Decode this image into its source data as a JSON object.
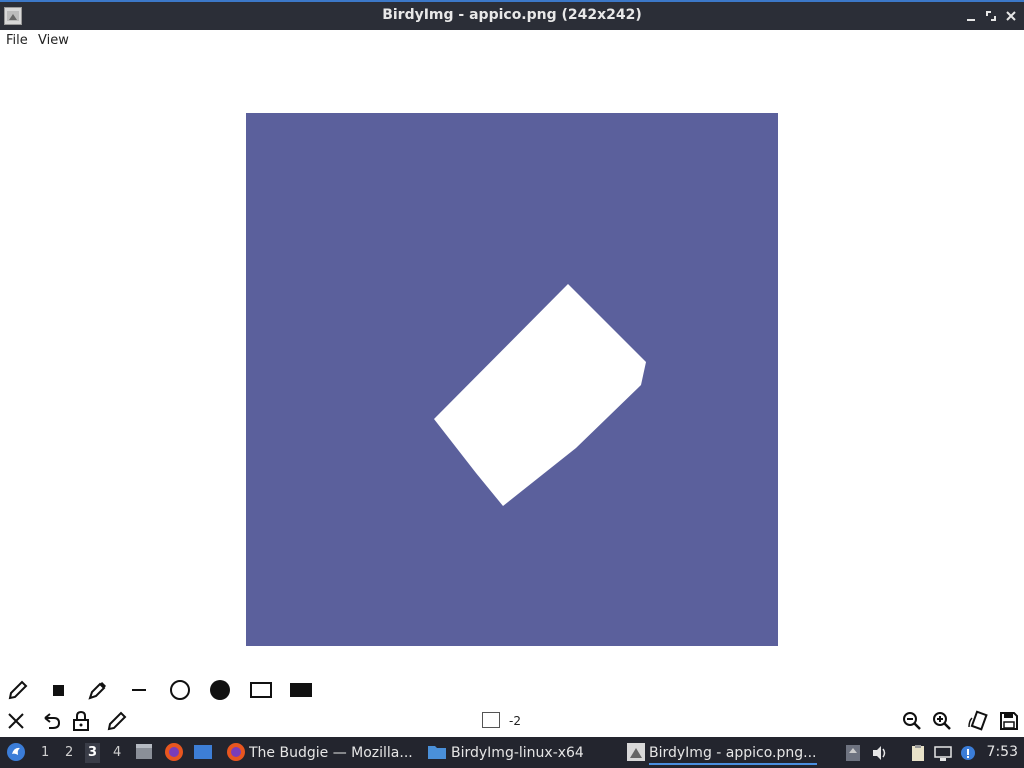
{
  "window": {
    "title": "BirdyImg - appico.png (242x242)",
    "buttons": [
      "minimize",
      "maximize",
      "close"
    ]
  },
  "menu": {
    "items": [
      {
        "label": "File"
      },
      {
        "label": "View"
      }
    ]
  },
  "image": {
    "background_color": "#5b609c",
    "shape_color": "#ffffff"
  },
  "draw_toolbar": {
    "tools": [
      "pencil-icon",
      "small-square-icon",
      "eyedropper-icon",
      "line-icon",
      "circle-outline-icon",
      "circle-filled-icon",
      "rectangle-outline-icon",
      "rectangle-filled-icon"
    ]
  },
  "bottom_toolbar": {
    "left_tools": [
      "close-icon",
      "undo-icon",
      "lock-icon",
      "edit-icon"
    ],
    "brush_size": "-2",
    "right_tools": [
      "zoom-out-icon",
      "zoom-in-icon",
      "rotate-icon",
      "save-icon"
    ]
  },
  "taskbar": {
    "workspaces": [
      "1",
      "2",
      "3",
      "4"
    ],
    "active_workspace": "3",
    "tasks": [
      {
        "label": "The Budgie — Mozilla..."
      },
      {
        "label": "BirdyImg-linux-x64"
      },
      {
        "label": "BirdyImg - appico.png..."
      }
    ],
    "clock": "7:53"
  }
}
